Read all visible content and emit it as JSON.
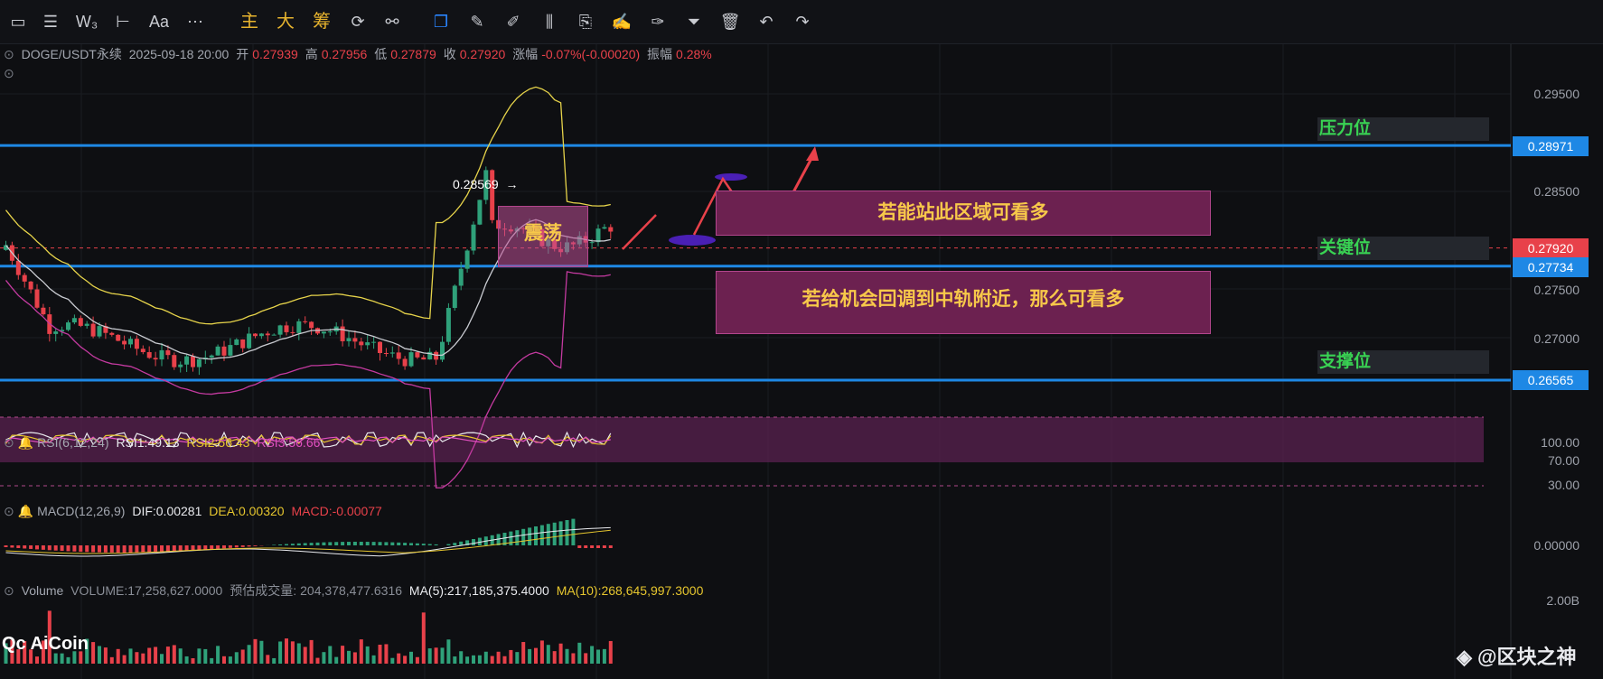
{
  "toolbar": {
    "buttons": [
      {
        "name": "rectangle-tool-icon",
        "glyph": "▭"
      },
      {
        "name": "menu-icon",
        "glyph": "☰"
      },
      {
        "name": "wave-tool-icon",
        "glyph": "W₃"
      },
      {
        "name": "horizontal-line-icon",
        "glyph": "⊢"
      },
      {
        "name": "text-tool-icon",
        "glyph": "Aa"
      },
      {
        "name": "more-icon",
        "glyph": "⋯"
      },
      {
        "name": "main-indicator-button",
        "glyph": "主"
      },
      {
        "name": "large-button",
        "glyph": "大"
      },
      {
        "name": "chips-button",
        "glyph": "筹"
      },
      {
        "name": "sync-icon",
        "glyph": "⟳"
      },
      {
        "name": "chart-tools-icon",
        "glyph": "⚯"
      },
      {
        "name": "copy-icon",
        "glyph": "❐"
      },
      {
        "name": "ruler-icon",
        "glyph": "✎"
      },
      {
        "name": "brush-icon",
        "glyph": "✐"
      },
      {
        "name": "candle-icon",
        "glyph": "⫼"
      },
      {
        "name": "clipboard-icon",
        "glyph": "⎘"
      },
      {
        "name": "edit-icon",
        "glyph": "✍"
      },
      {
        "name": "draw-icon",
        "glyph": "✑"
      },
      {
        "name": "filter-icon",
        "glyph": "⏷"
      },
      {
        "name": "trash-icon",
        "glyph": "🗑"
      },
      {
        "name": "undo-icon",
        "glyph": "↶"
      },
      {
        "name": "redo-icon",
        "glyph": "↷"
      }
    ]
  },
  "header": {
    "symbol": "DOGE/USDT永续",
    "datetime": "2025-09-18 20:00",
    "open_label": "开",
    "open": "0.27939",
    "high_label": "高",
    "high": "0.27956",
    "low_label": "低",
    "low": "0.27879",
    "close_label": "收",
    "close": "0.27920",
    "change_label": "涨幅",
    "change": "-0.07%(-0.00020)",
    "amp_label": "振幅",
    "amp": "0.28%"
  },
  "rsi": {
    "label": "RSI(6,12,24)",
    "rsi1": "RSI1:49.13",
    "rsi2": "RSI2:56.43",
    "rsi3": "RSI3:56.66"
  },
  "macd": {
    "label": "MACD(12,26,9)",
    "dif": "DIF:0.00281",
    "dea": "DEA:0.00320",
    "macd": "MACD:-0.00077"
  },
  "volume": {
    "label": "Volume",
    "vol": "VOLUME:17,258,627.0000",
    "est_label": "预估成交量:",
    "est": "204,378,477.6316",
    "ma5": "MA(5):217,185,375.4000",
    "ma10": "MA(10):268,645,997.3000"
  },
  "axis": {
    "price_ticks": [
      "0.29500",
      "0.28500",
      "0.27500",
      "0.27000",
      "0.26565"
    ],
    "rsi_ticks": [
      "100.00",
      "70.00",
      "30.00"
    ],
    "macd_tick": "0.00000",
    "vol_tick": "2.00B"
  },
  "price_tags": {
    "resistance": "0.28971",
    "current": "0.27920",
    "key": "0.27734",
    "support": "0.26565"
  },
  "zones": {
    "resistance": "压力位",
    "key": "关键位",
    "support": "支撑位"
  },
  "annotations": {
    "high_marker": "0.28569",
    "consolidation": "震荡",
    "bull_box": "若能站此区域可看多",
    "pullback_box": "若给机会回调到中轨附近，那么可看多"
  },
  "watermarks": {
    "aicoin": "AiCoin",
    "aicoin_mark": "Qc",
    "author_mark": "@",
    "author": "区块之神"
  },
  "colors": {
    "background": "#0e0f12",
    "up": "#2fa17a",
    "down": "#e8414a",
    "level_line": "#1e88e5",
    "boll": "#e6d34a",
    "zone_text": "#39d353"
  },
  "chart_data": {
    "type": "line",
    "title": "DOGE/USDT永续",
    "levels": {
      "resistance": 0.28971,
      "key": 0.27734,
      "support": 0.26565,
      "last": 0.2792,
      "marked_high": 0.28569
    },
    "ylim": [
      0.264,
      0.297
    ]
  }
}
